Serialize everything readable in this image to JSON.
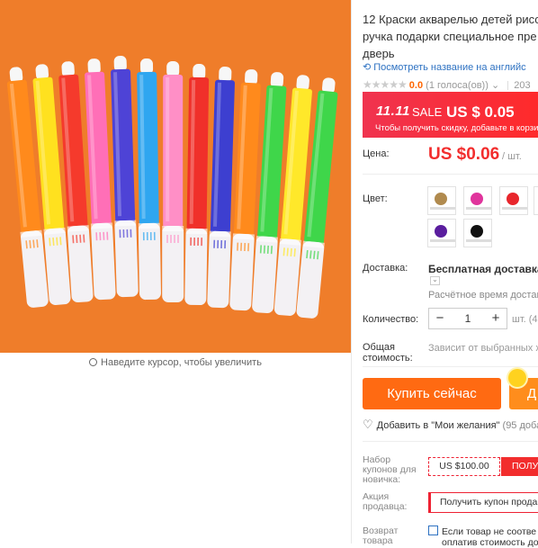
{
  "product": {
    "title_lines": [
      "12 Краски акварелью детей рисо",
      "ручка подарки специальное пре",
      "дверь"
    ],
    "translate_link": "Посмотреть название на английс",
    "rating": {
      "stars": "★★★★★",
      "score": "0.0",
      "votes": "(1 голоса(ов))",
      "orders_partial": "203"
    }
  },
  "gallery": {
    "zoom_hint": "Наведите курсор, чтобы увеличить",
    "marker_colors": [
      "#ff8a1c",
      "#ffe11f",
      "#f53a2c",
      "#ff6fb7",
      "#4e43d6",
      "#2fa6f0",
      "#ff8fc6",
      "#f0302a",
      "#3d3fd0",
      "#ff8a1c",
      "#3fd64a",
      "#ffe82a",
      "#3fd64a"
    ]
  },
  "sale": {
    "tag": "11.11",
    "tag_word": "SALE",
    "price": "US $ 0.05",
    "note": "Чтобы получить скидку, добавьте в корзину"
  },
  "price": {
    "label": "Цена:",
    "amount": "US $0.06",
    "unit": "/ шт."
  },
  "color": {
    "label": "Цвет:",
    "swatches": [
      {
        "name": "brown",
        "color": "#b08a4e"
      },
      {
        "name": "magenta",
        "color": "#e0349c"
      },
      {
        "name": "red",
        "color": "#e8262c"
      },
      {
        "name": "purple",
        "color": "#5a1d9e"
      },
      {
        "name": "black",
        "color": "#111111"
      }
    ]
  },
  "shipping": {
    "label": "Доставка:",
    "value": "Бесплатная доставка в",
    "estimate": "Расчётное время достав"
  },
  "quantity": {
    "label": "Количество:",
    "minus": "−",
    "value": "1",
    "plus": "+",
    "unit": "шт. (4"
  },
  "total": {
    "label_line1": "Общая",
    "label_line2": "стоимость:",
    "value": "Зависит от выбранных х"
  },
  "actions": {
    "buy_now": "Купить сейчас",
    "add_cart_partial": "Д"
  },
  "wishlist": {
    "label": "Добавить в \"Мои желания\"",
    "count": "(95 доба"
  },
  "coupon": {
    "label_lines": [
      "Набор",
      "купонов для",
      "новичка:"
    ],
    "amount": "US $100.00",
    "get": "ПОЛУ"
  },
  "seller_promo": {
    "label_lines": [
      "Акция",
      "продавца:"
    ],
    "button": "Получить купон прода"
  },
  "returns": {
    "label_lines": [
      "Возврат",
      "товара"
    ],
    "lines": [
      "Если товар не соотве",
      "оплатив стоимость до"
    ]
  }
}
